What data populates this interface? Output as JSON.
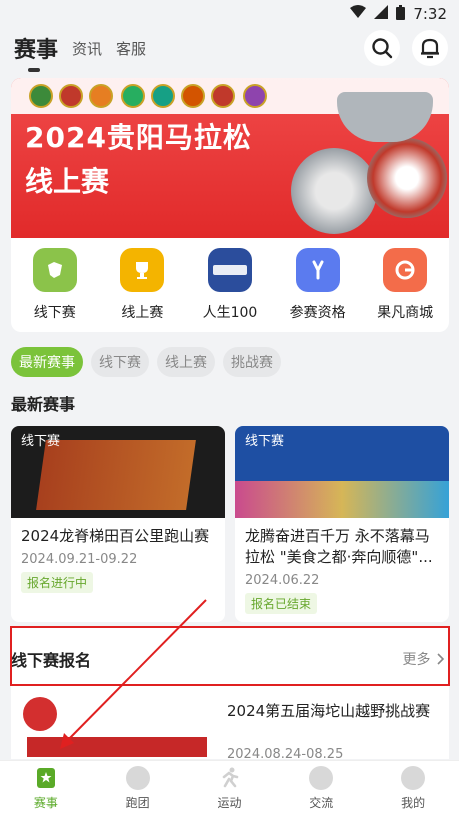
{
  "status_bar": {
    "time": "7:32"
  },
  "header": {
    "tabs": [
      "赛事",
      "资讯",
      "客服"
    ]
  },
  "banner": {
    "title": "2024贵阳马拉松",
    "subtitle": "线上赛"
  },
  "quick_links": [
    {
      "label": "线下赛",
      "icon": "marathon-icon",
      "color": "#8bc34a"
    },
    {
      "label": "线上赛",
      "icon": "trophy-icon",
      "color": "#f4b400"
    },
    {
      "label": "人生100",
      "icon": "beyond-icon",
      "color": "#2b4d9c"
    },
    {
      "label": "参赛资格",
      "icon": "qualification-icon",
      "color": "#5b7bef"
    },
    {
      "label": "果凡商城",
      "icon": "shop-icon",
      "color": "#f36c4a"
    }
  ],
  "filters": [
    "最新赛事",
    "线下赛",
    "线上赛",
    "挑战赛"
  ],
  "section_latest": "最新赛事",
  "events": [
    {
      "tag": "线下赛",
      "title": "2024龙脊梯田百公里跑山赛",
      "date": "2024.09.21-09.22",
      "status": "报名进行中"
    },
    {
      "tag": "线下赛",
      "title": "龙腾奋进百千万 永不落幕马拉松 \"美食之都·奔向顺德\"...",
      "date": "2024.06.22",
      "status": "报名已结束"
    }
  ],
  "offline_section": {
    "title": "线下赛报名",
    "more": "更多"
  },
  "offline_item": {
    "title": "2024第五届海坨山越野挑战赛",
    "date": "2024.08.24-08.25"
  },
  "bottom_nav": [
    "赛事",
    "跑团",
    "运动",
    "交流",
    "我的"
  ]
}
